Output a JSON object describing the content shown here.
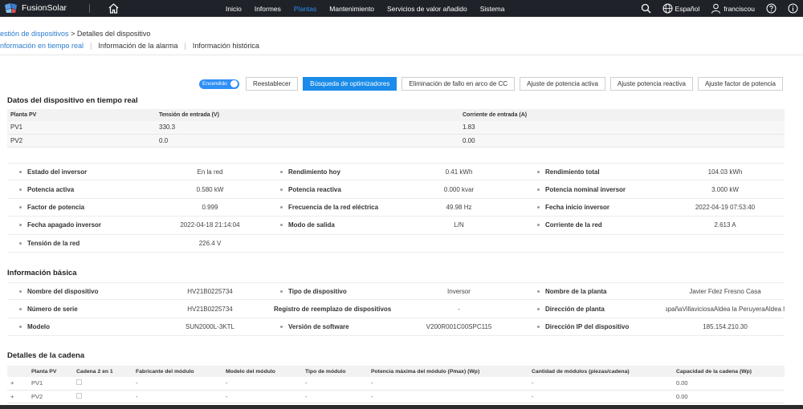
{
  "app": {
    "name": "FusionSolar"
  },
  "nav": [
    "Inicio",
    "Informes",
    "Plantas",
    "Mantenimiento",
    "Servicios de valor añadido",
    "Sistema"
  ],
  "nav_active": "Plantas",
  "topright": {
    "language": "Español",
    "user": "franciscou"
  },
  "breadcrumb": {
    "parent": "estión de dispositivos",
    "sep": " > ",
    "current": "Detalles del dispositivo"
  },
  "subtabs": [
    "nformación en tiempo real",
    "Información de la alarma",
    "Información histórica"
  ],
  "actions": {
    "toggle_label": "Encendido",
    "buttons": [
      "Reestablecer",
      "Búsqueda de optimizadores",
      "Eliminación de fallo en arco de CC",
      "Ajuste de potencia activa",
      "Ajuste potencia reactiva",
      "Ajuste factor de potencia"
    ]
  },
  "realtime": {
    "title": "Datos del dispositivo en tiempo real",
    "headers": [
      "Planta PV",
      "Tensión de entrada (V)",
      "Corriente de entrada (A)"
    ],
    "rows": [
      [
        "PV1",
        "330.3",
        "1.83"
      ],
      [
        "PV2",
        "0.0",
        "0.00"
      ]
    ]
  },
  "status": [
    [
      [
        "Estado del inversor",
        "En la red"
      ],
      [
        "Rendimiento hoy",
        "0.41 kWh"
      ],
      [
        "Rendimiento total",
        "104.03 kWh"
      ]
    ],
    [
      [
        "Potencia activa",
        "0.580 kW"
      ],
      [
        "Potencia reactiva",
        "0.000 kvar"
      ],
      [
        "Potencia nominal inversor",
        "3.000 kW"
      ]
    ],
    [
      [
        "Factor de potencia",
        "0.999"
      ],
      [
        "Frecuencia de la red eléctrica",
        "49.98 Hz"
      ],
      [
        "Fecha inicio inversor",
        "2022-04-19 07:53:40"
      ]
    ],
    [
      [
        "Fecha apagado inversor",
        "2022-04-18 21:14:04"
      ],
      [
        "Modo de salida",
        "L/N"
      ],
      [
        "Corriente de la red",
        "2.613 A"
      ]
    ],
    [
      [
        "Tensión de la red",
        "226.4 V"
      ]
    ]
  ],
  "basic": {
    "title": "Información básica",
    "rows": [
      [
        [
          "Nombre del dispositivo",
          "HV21B0225734"
        ],
        [
          "Tipo de dispositivo",
          "Inversor"
        ],
        [
          "Nombre de la planta",
          "Javier Fdez Fresno Casa"
        ]
      ],
      [
        [
          "Número de serie",
          "HV21B0225734"
        ],
        [
          "Registro de reemplazo de dispositivos",
          "-"
        ],
        [
          "Dirección de planta",
          "EspañaVillaviciosaAldea la PeruyeraAldea l..."
        ]
      ],
      [
        [
          "Modelo",
          "SUN2000L-3KTL"
        ],
        [
          "Versión de software",
          "V200R001C00SPC115"
        ],
        [
          "Dirección IP del dispositivo",
          "185.154.210.30"
        ]
      ]
    ]
  },
  "chain": {
    "title": "Detalles de la cadena",
    "headers": [
      "",
      "Planta PV",
      "Cadena 2 en 1",
      "Fabricante del módulo",
      "Modelo del módulo",
      "Tipo de módulo",
      "Potencia máxima del módulo (Pmax) (Wp)",
      "Cantidad de módulos (piezas/cadena)",
      "Capacidad de la cadena (Wp)"
    ],
    "rows": [
      [
        "+",
        "PV1",
        "",
        "-",
        "-",
        "-",
        "-",
        "-",
        "0.00"
      ],
      [
        "+",
        "PV2",
        "",
        "-",
        "-",
        "-",
        "-",
        "-",
        "0.00"
      ]
    ]
  }
}
